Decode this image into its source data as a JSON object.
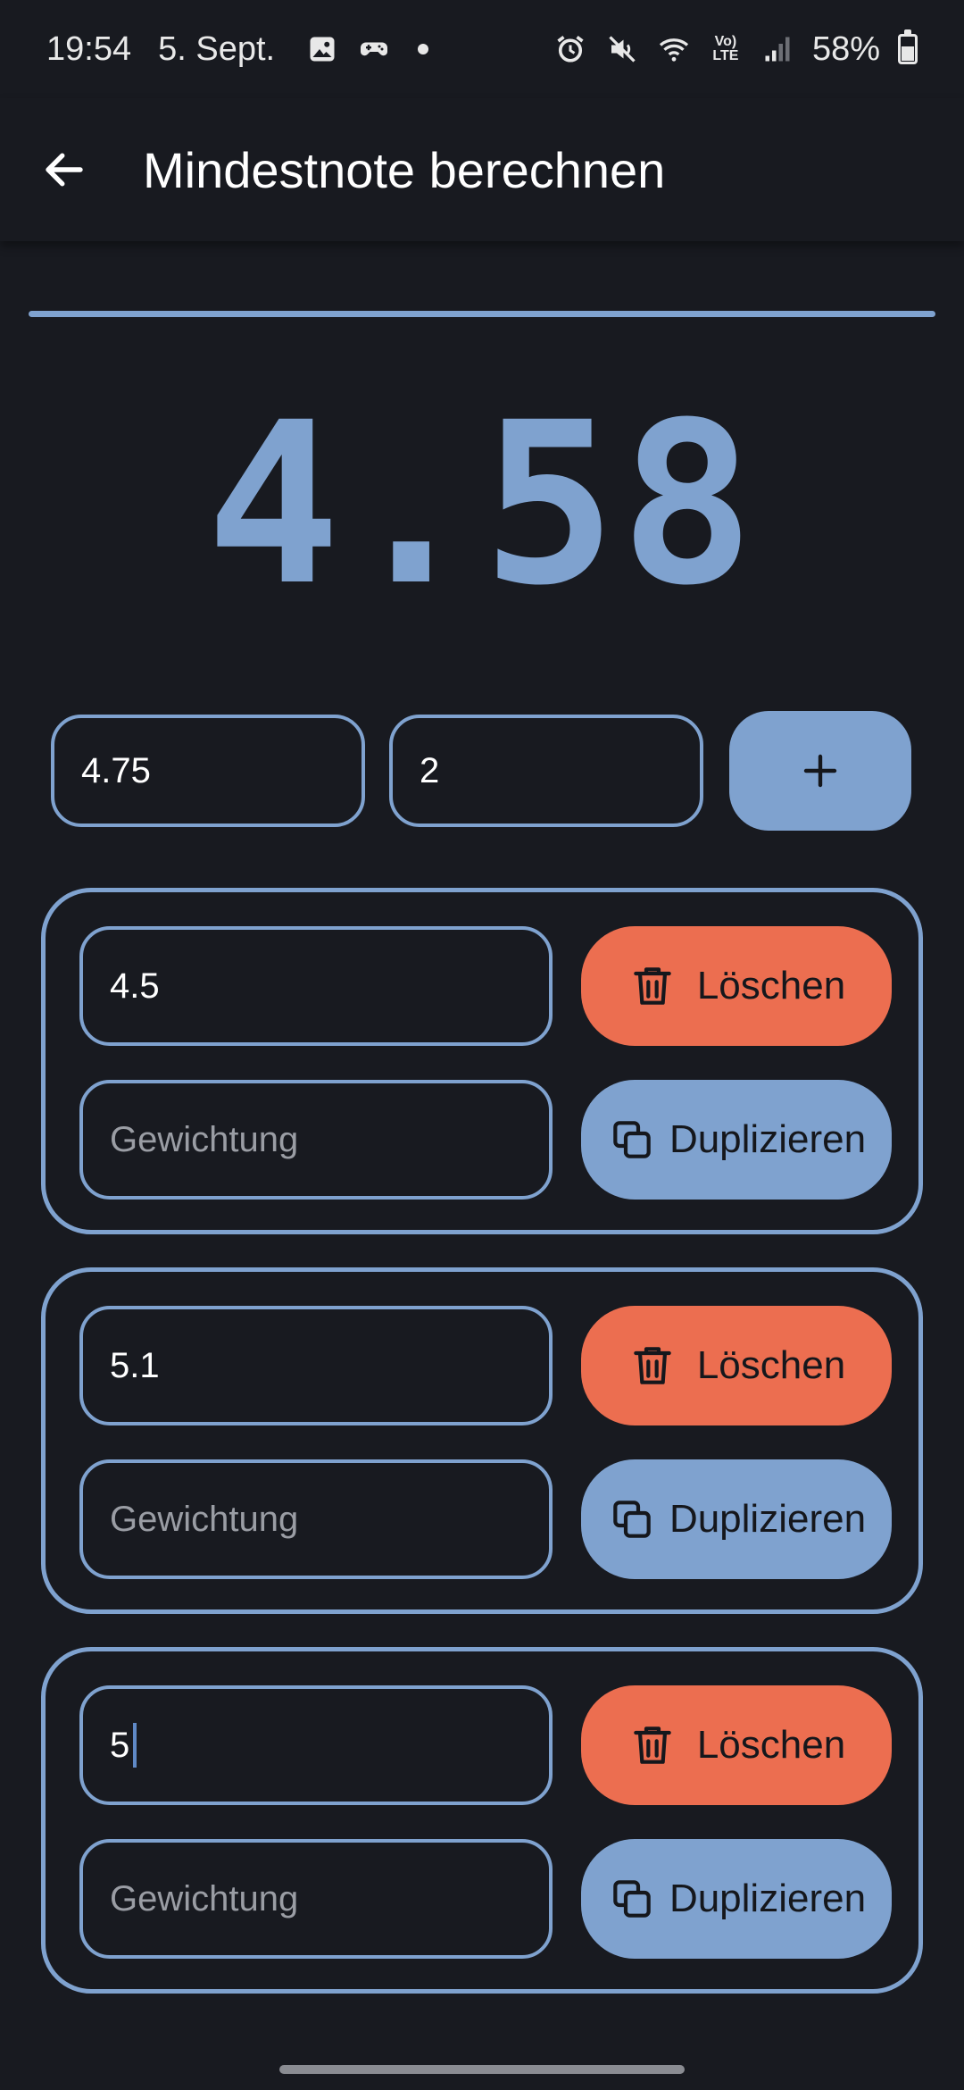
{
  "status_bar": {
    "time": "19:54",
    "date": "5. Sept.",
    "battery": "58%",
    "lte_label": "Vo) LTE",
    "icons": [
      "gallery-icon",
      "game-controller-icon",
      "notification-dot-icon",
      "alarm-icon",
      "mute-icon",
      "wifi-icon",
      "lte-icon",
      "signal-icon",
      "battery-icon"
    ]
  },
  "app_bar": {
    "title": "Mindestnote berechnen",
    "back_icon": "arrow-back-icon"
  },
  "colors": {
    "background": "#181a20",
    "accent": "#7fa2cf",
    "delete": "#ec6e50"
  },
  "progress": {
    "value": 1.0
  },
  "result": {
    "value": "4.58"
  },
  "new_entry": {
    "target_grade": "4.75",
    "weight": "2",
    "add_icon": "plus-icon"
  },
  "cards": [
    {
      "grade": "4.5",
      "weight_placeholder": "Gewichtung",
      "delete_label": "Löschen",
      "duplicate_label": "Duplizieren"
    },
    {
      "grade": "5.1",
      "weight_placeholder": "Gewichtung",
      "delete_label": "Löschen",
      "duplicate_label": "Duplizieren"
    },
    {
      "grade": "5",
      "weight_placeholder": "Gewichtung",
      "delete_label": "Löschen",
      "duplicate_label": "Duplizieren",
      "focused": true
    }
  ]
}
